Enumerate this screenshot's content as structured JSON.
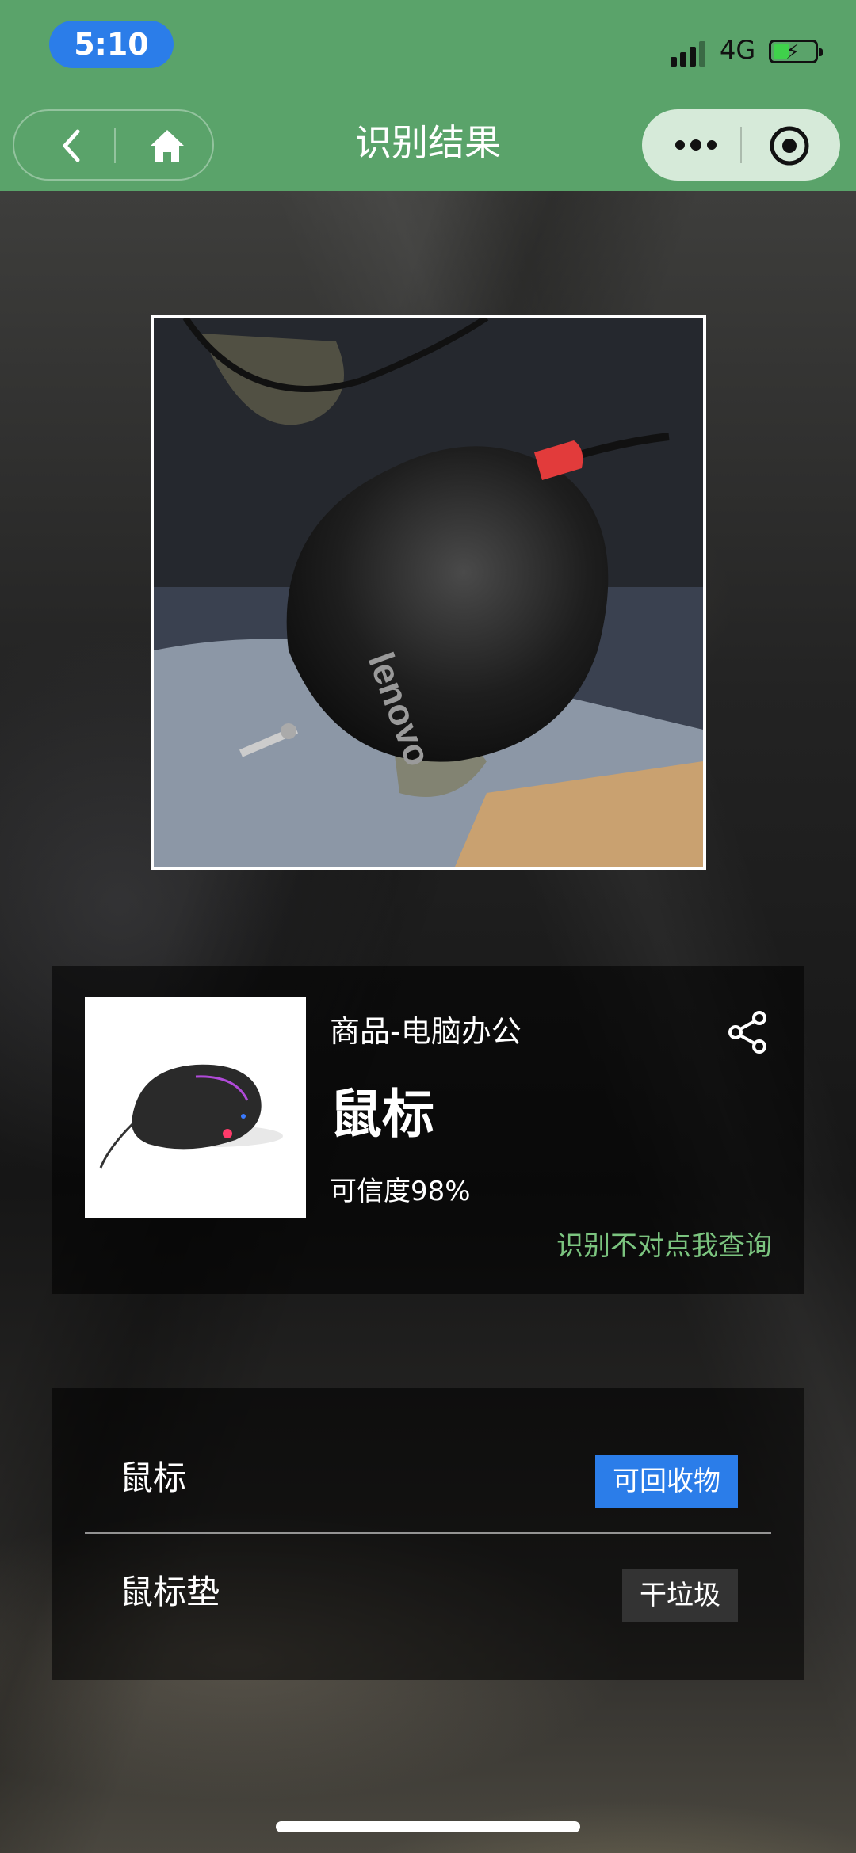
{
  "status_bar": {
    "time": "5:10",
    "network": "4G",
    "colors": {
      "time_pill": "#2b7de9",
      "battery_fill": "#3fd14b"
    }
  },
  "nav": {
    "title": "识别结果",
    "back_icon": "back-icon",
    "home_icon": "home-icon",
    "more_icon": "more-icon",
    "target_icon": "target-icon",
    "bar_color": "#5aa36a"
  },
  "result": {
    "category": "商品-电脑办公",
    "name": "鼠标",
    "confidence": "可信度98%",
    "query_link": "识别不对点我查询",
    "share_icon": "share-icon",
    "link_color": "#7bc47f"
  },
  "list": {
    "items": [
      {
        "label": "鼠标",
        "badge": "可回收物",
        "badge_color": "#2b7de9"
      },
      {
        "label": "鼠标垫",
        "badge": "干垃圾",
        "badge_color": "#333333"
      }
    ]
  }
}
